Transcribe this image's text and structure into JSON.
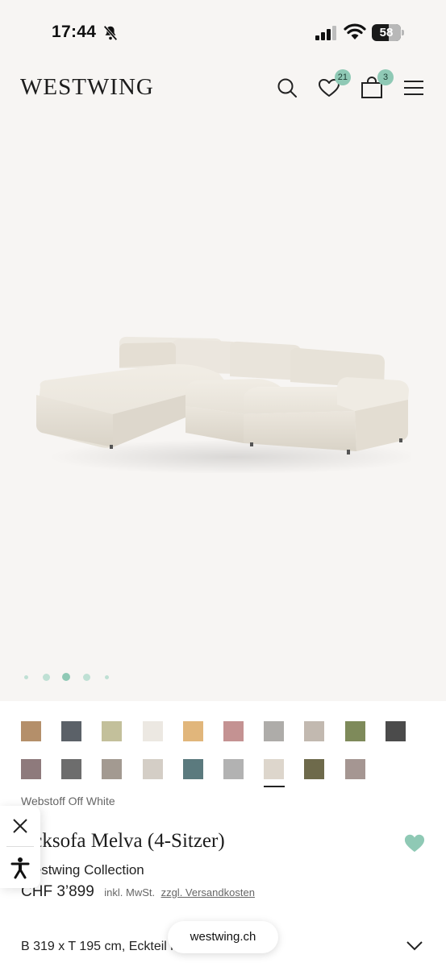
{
  "status_bar": {
    "time": "17:44",
    "battery_level": "58",
    "battery_fraction": 0.58,
    "icons": [
      "bell-slash-icon",
      "cellular-signal-icon",
      "wifi-icon",
      "battery-icon"
    ]
  },
  "header": {
    "logo": "WESTWING",
    "wishlist_count": "21",
    "cart_count": "3",
    "icons": [
      "search-icon",
      "heart-icon",
      "shopping-bag-icon",
      "hamburger-menu-icon"
    ]
  },
  "carousel": {
    "total_images": 5,
    "active_index": 2
  },
  "colors": {
    "accent": "#8fc9b5",
    "stage_background": "#f7f5f3"
  },
  "swatches": {
    "row1": [
      "#b48f6a",
      "#5b6168",
      "#c3c09b",
      "#ece8e2",
      "#e1b67b",
      "#c49292",
      "#aeaca9",
      "#c2b9b0",
      "#7e8a5a",
      "#4b4b4b"
    ],
    "row2": [
      "#8e7a7c",
      "#6d6d6d",
      "#a39a91",
      "#d4cec6",
      "#5b7a7e",
      "#b2b2b2",
      "#ddd6cc",
      "#6e6a4b",
      "#a59692"
    ],
    "selected_row": 2,
    "selected_index": 6
  },
  "product": {
    "variant": "Webstoff Off White",
    "title": "Ecksofa Melva (4-Sitzer)",
    "brand": "Westwing Collection",
    "price": "CHF 3’899",
    "tax_note": "inkl. MwSt.",
    "shipping_link": "zzgl. Versandkosten",
    "dimensions": "B 319 x T 195 cm, Eckteil links"
  },
  "browser": {
    "url": "westwing.ch"
  },
  "accessibility_widget": {
    "icons": [
      "close-icon",
      "accessibility-icon"
    ]
  }
}
